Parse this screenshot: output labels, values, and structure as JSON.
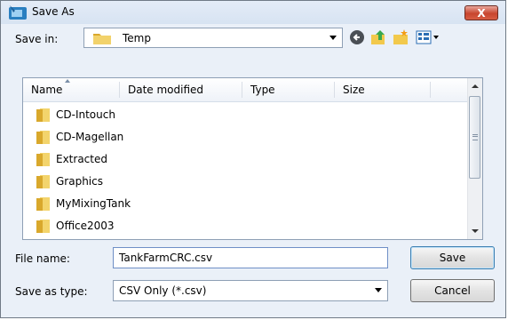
{
  "window": {
    "title": "Save As",
    "close_label": "X"
  },
  "save_in": {
    "label": "Save in:",
    "value": "Temp"
  },
  "toolbar_icons": [
    "back-icon",
    "up-folder-icon",
    "new-folder-icon",
    "views-menu-icon"
  ],
  "columns": [
    {
      "label": "Name"
    },
    {
      "label": "Date modified"
    },
    {
      "label": "Type"
    },
    {
      "label": "Size"
    }
  ],
  "files": [
    {
      "name": "CD-Intouch"
    },
    {
      "name": "CD-Magellan"
    },
    {
      "name": "Extracted"
    },
    {
      "name": "Graphics"
    },
    {
      "name": "MyMixingTank"
    },
    {
      "name": "Office2003"
    }
  ],
  "file_name": {
    "label": "File name:",
    "value": "TankFarmCRC.csv"
  },
  "save_as_type": {
    "label": "Save as type:",
    "value": "CSV Only (*.csv)"
  },
  "buttons": {
    "save": "Save",
    "cancel": "Cancel"
  },
  "colors": {
    "folder": "#e9c34a",
    "dialog_bg": "#eaf0f8",
    "close": "#c8452e"
  }
}
